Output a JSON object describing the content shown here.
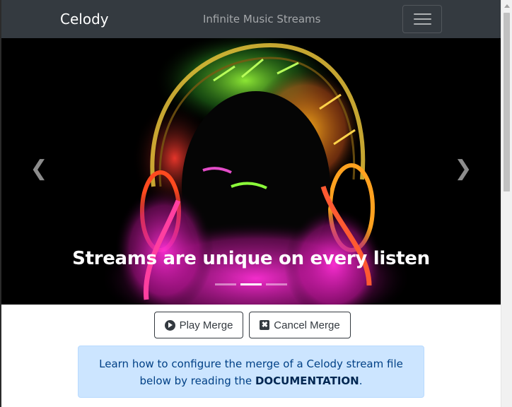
{
  "navbar": {
    "brand": "Celody",
    "tagline": "Infinite Music Streams",
    "toggler_icon": "hamburger-icon"
  },
  "carousel": {
    "caption": "Streams are unique on every listen",
    "prev_icon": "chevron-left-icon",
    "next_icon": "chevron-right-icon",
    "prev_glyph": "❮",
    "next_glyph": "❯",
    "indicator_count": 3,
    "active_indicator": 1
  },
  "actions": {
    "play_label": "Play Merge",
    "cancel_label": "Cancel Merge",
    "play_icon": "play-circle-icon",
    "cancel_icon": "close-square-icon",
    "cancel_glyph": "✖"
  },
  "alert": {
    "line1": "Learn how to configure the merge of a Celody stream file",
    "line2_prefix": "below by reading the",
    "link": "DOCUMENTATION",
    "line2_suffix": "."
  },
  "colors": {
    "navbar_bg": "#343a40",
    "alert_bg": "#cce5ff",
    "alert_text": "#004085"
  }
}
